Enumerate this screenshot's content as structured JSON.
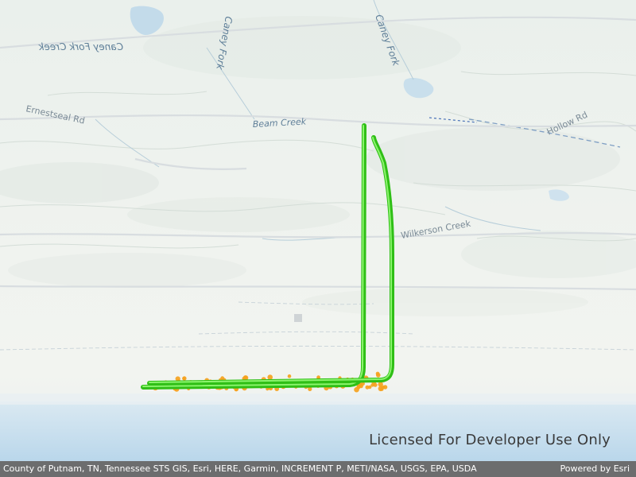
{
  "map": {
    "labels": {
      "caney_fork_creek_1": "Caney Fork Creek",
      "caney_fork_creek_2": "Caney Fork",
      "caney_fork_3": "Caney Fork",
      "beam_creek": "Beam Creek",
      "road_1": "Ernestseal Rd",
      "road_2": "Wilkerson Creek",
      "road_3": "Hollow Rd"
    },
    "colors": {
      "well_path": "#3ddc22",
      "well_path_glow": "#7cf060",
      "event_point": "#f5a21e",
      "water": "#bcd8ea",
      "terrain_base": "#eef2ee"
    },
    "icons": {
      "well_path": "green-3d-tube-polyline",
      "event_point": "orange-dot-marker"
    }
  },
  "watermark": {
    "text": "Licensed For Developer Use Only"
  },
  "attribution": {
    "text": "County of Putnam, TN, Tennessee STS GIS, Esri, HERE, Garmin, INCREMENT P, METI/NASA, USGS, EPA, USDA",
    "powered_by": "Powered by Esri"
  }
}
